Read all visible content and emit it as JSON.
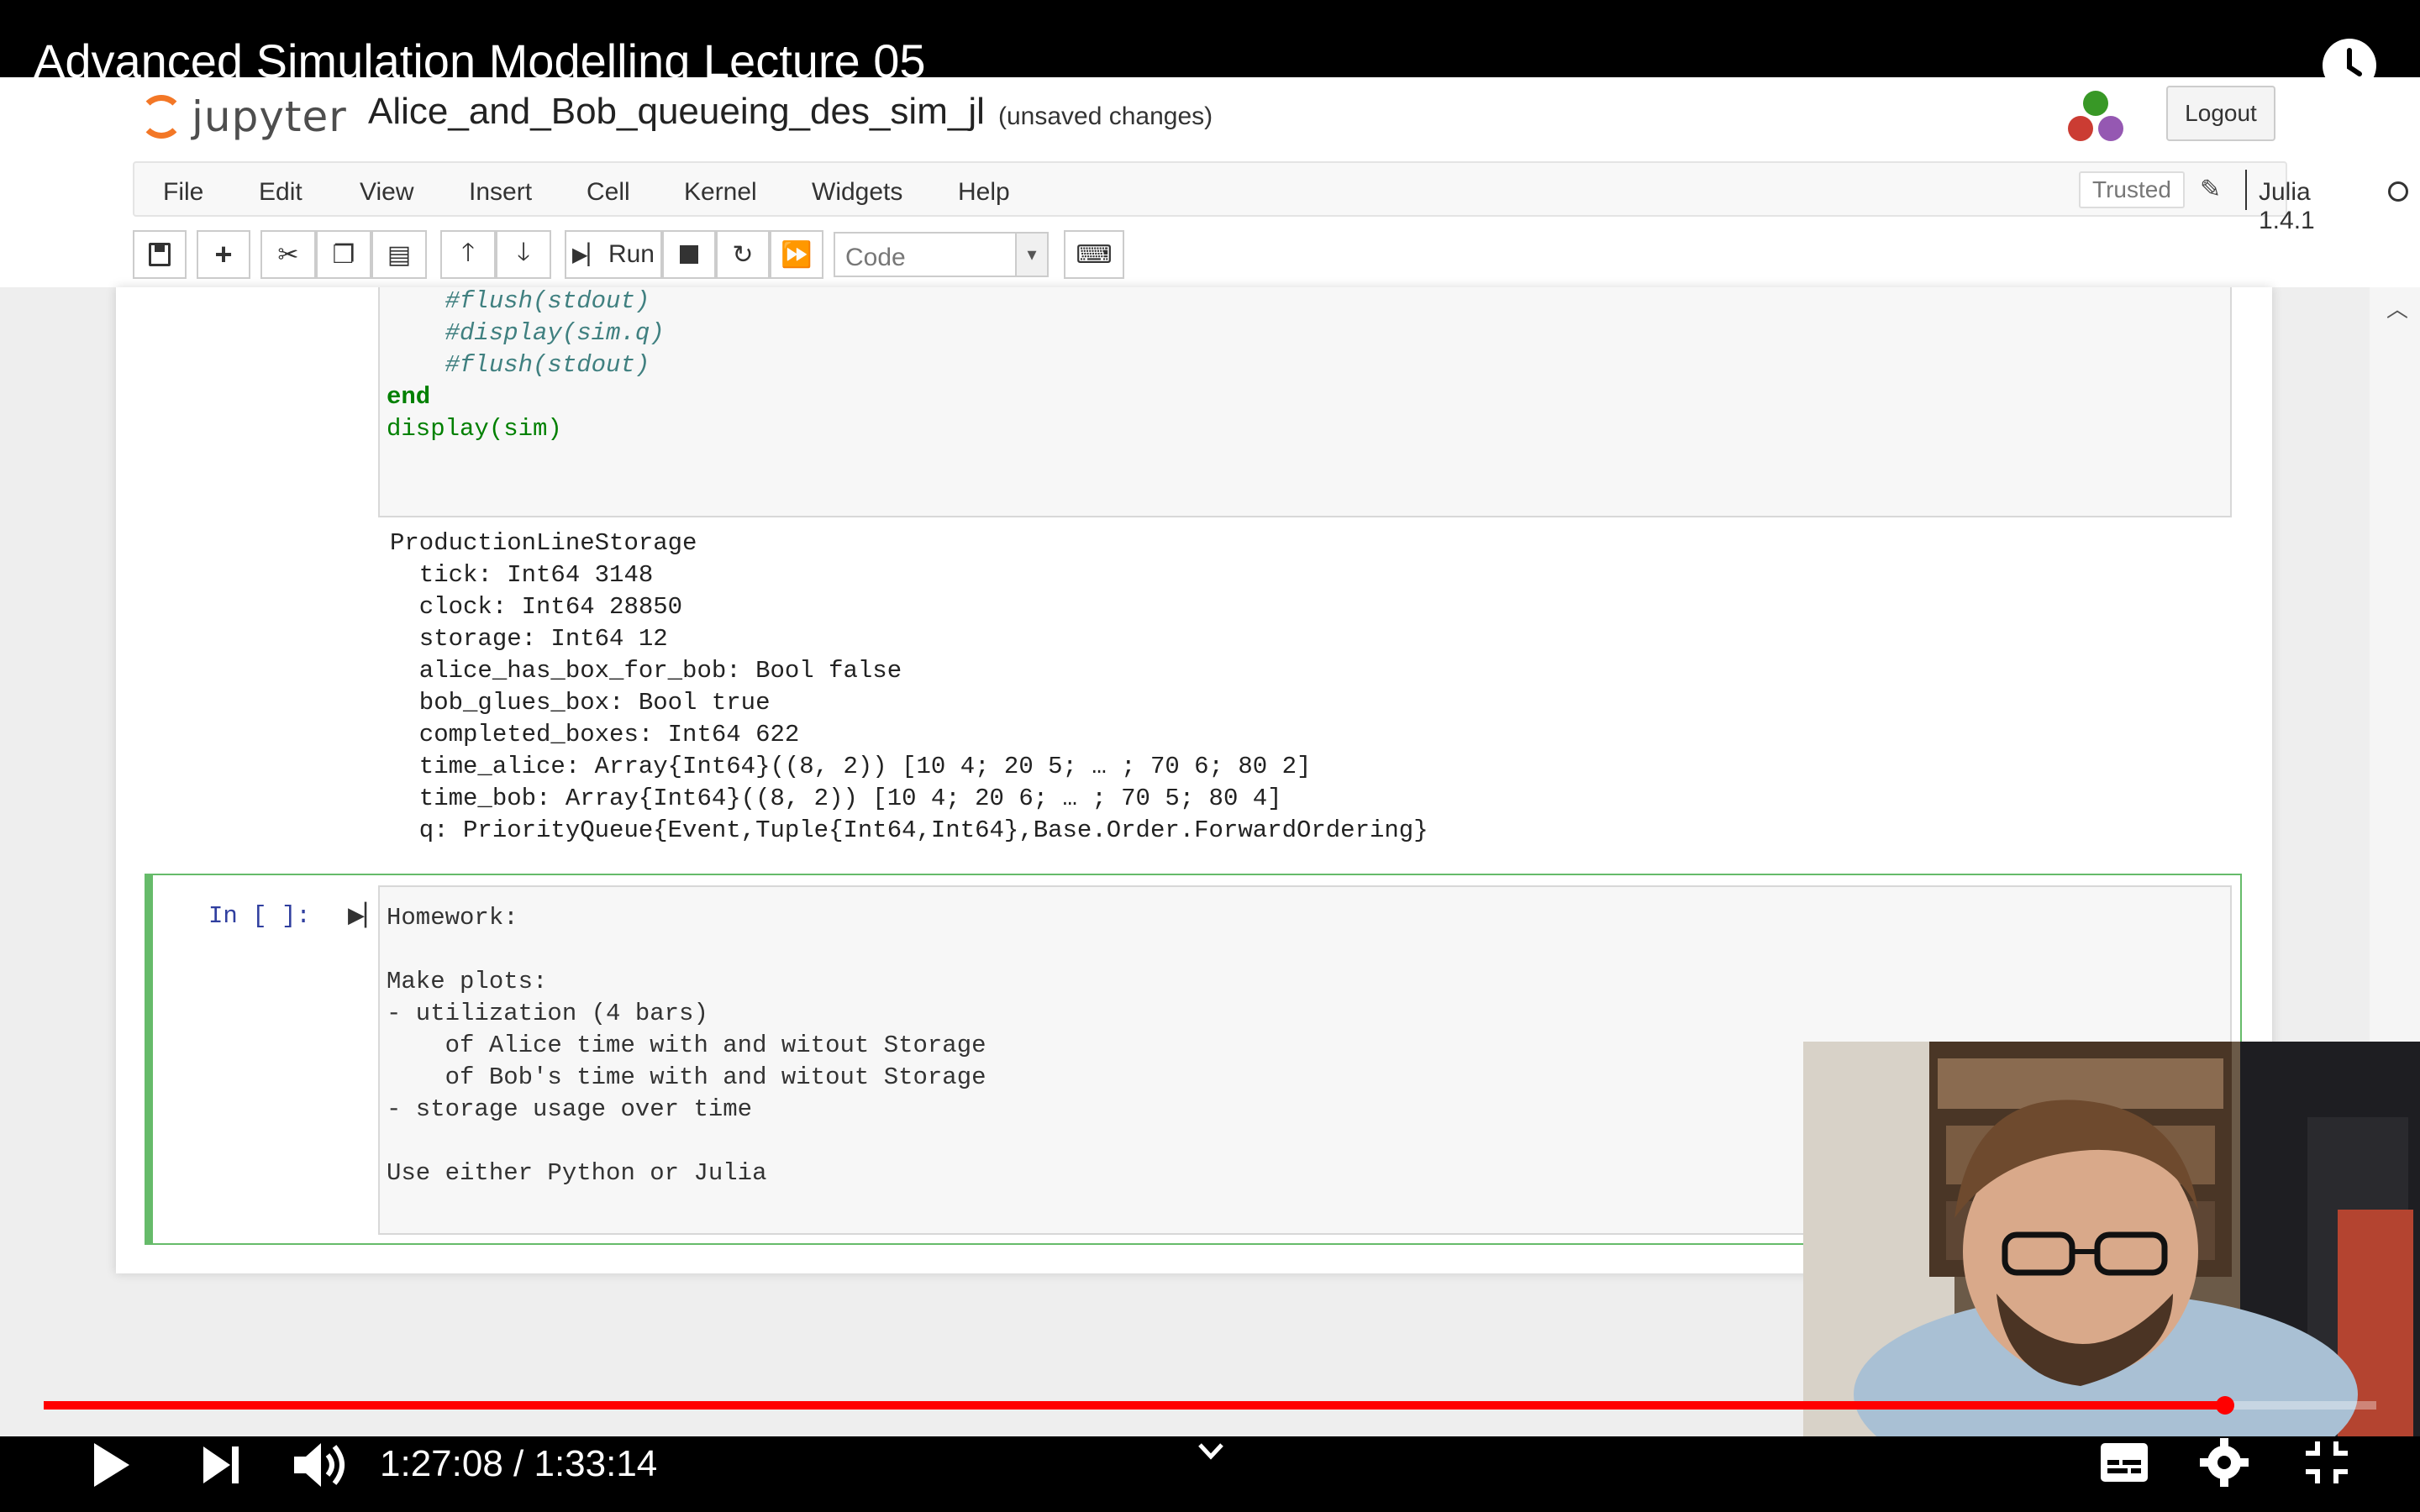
{
  "video": {
    "title": "Advanced Simulation Modelling Lecture 05",
    "current_time": "1:27:08",
    "duration": "1:33:14",
    "time_display": "1:27:08 / 1:33:14",
    "progress": 0.935,
    "accent_color": "#ff0000"
  },
  "jupyter": {
    "logo_text": "jupyter",
    "notebook_name": "Alice_and_Bob_queueing_des_sim_jl",
    "save_status": "(unsaved changes)",
    "logout_label": "Logout",
    "menu": [
      "File",
      "Edit",
      "View",
      "Insert",
      "Cell",
      "Kernel",
      "Widgets",
      "Help"
    ],
    "trusted_label": "Trusted",
    "kernel_name": "Julia 1.4.1",
    "toolbar": {
      "run_label": "Run",
      "cell_type": "Code",
      "icons": [
        "save-icon",
        "plus-icon",
        "scissors-icon",
        "copy-icon",
        "paste-icon",
        "arrow-up-icon",
        "arrow-down-icon",
        "run-icon",
        "stop-icon",
        "restart-icon",
        "fast-forward-icon",
        "keyboard-icon"
      ]
    }
  },
  "code_cell": {
    "lines": [
      {
        "text": "    #flush(stdout)",
        "kind": "comment"
      },
      {
        "text": "    #display(sim.q)",
        "kind": "comment"
      },
      {
        "text": "    #flush(stdout)",
        "kind": "comment"
      },
      {
        "text": "end",
        "kind": "kw"
      },
      {
        "text": "display(sim)",
        "kind": "call"
      }
    ]
  },
  "output": {
    "lines": [
      "ProductionLineStorage",
      "  tick: Int64 3148",
      "  clock: Int64 28850",
      "  storage: Int64 12",
      "  alice_has_box_for_bob: Bool false",
      "  bob_glues_box: Bool true",
      "  completed_boxes: Int64 622",
      "  time_alice: Array{Int64}((8, 2)) [10 4; 20 5; … ; 70 6; 80 2]",
      "  time_bob: Array{Int64}((8, 2)) [10 4; 20 6; … ; 70 5; 80 4]",
      "  q: PriorityQueue{Event,Tuple{Int64,Int64},Base.Order.ForwardOrdering}"
    ]
  },
  "md_cell": {
    "prompt": "In [ ]:",
    "lines": [
      "Homework:",
      "",
      "Make plots:",
      "- utilization (4 bars)",
      "    of Alice time with and witout Storage",
      "    of Bob's time with and witout Storage",
      "- storage usage over time",
      "",
      "Use either Python or Julia"
    ]
  }
}
